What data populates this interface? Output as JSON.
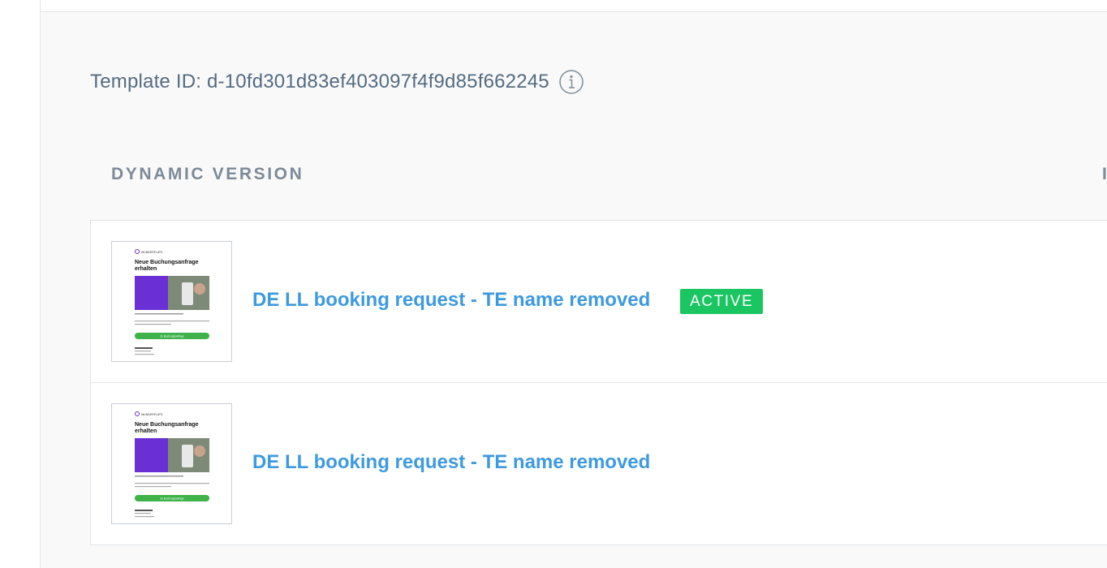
{
  "template": {
    "id_label": "Template ID: d-10fd301d83ef403097f4f9d85f662245",
    "info_icon": "info-icon"
  },
  "section": {
    "label": "DYNAMIC VERSION",
    "right_label_partial": "I"
  },
  "versions": [
    {
      "name": "DE LL booking request - TE name removed",
      "badge": "ACTIVE",
      "thumbnail": {
        "brand": "WUNDERFLATS",
        "heading": "Neue Buchungsanfrage erhalten",
        "button": "Zu Buchungsanfrage"
      }
    },
    {
      "name": "DE LL booking request - TE name removed",
      "badge": "",
      "thumbnail": {
        "brand": "WUNDERFLATS",
        "heading": "Neue Buchungsanfrage erhalten",
        "button": "Zu Buchungsanfrage"
      }
    }
  ],
  "colors": {
    "link": "#3d9ae0",
    "badge_active": "#1bc662",
    "thumb_purple": "#6b2fd6",
    "thumb_green": "#3fb24a",
    "muted_text": "#546b81"
  }
}
